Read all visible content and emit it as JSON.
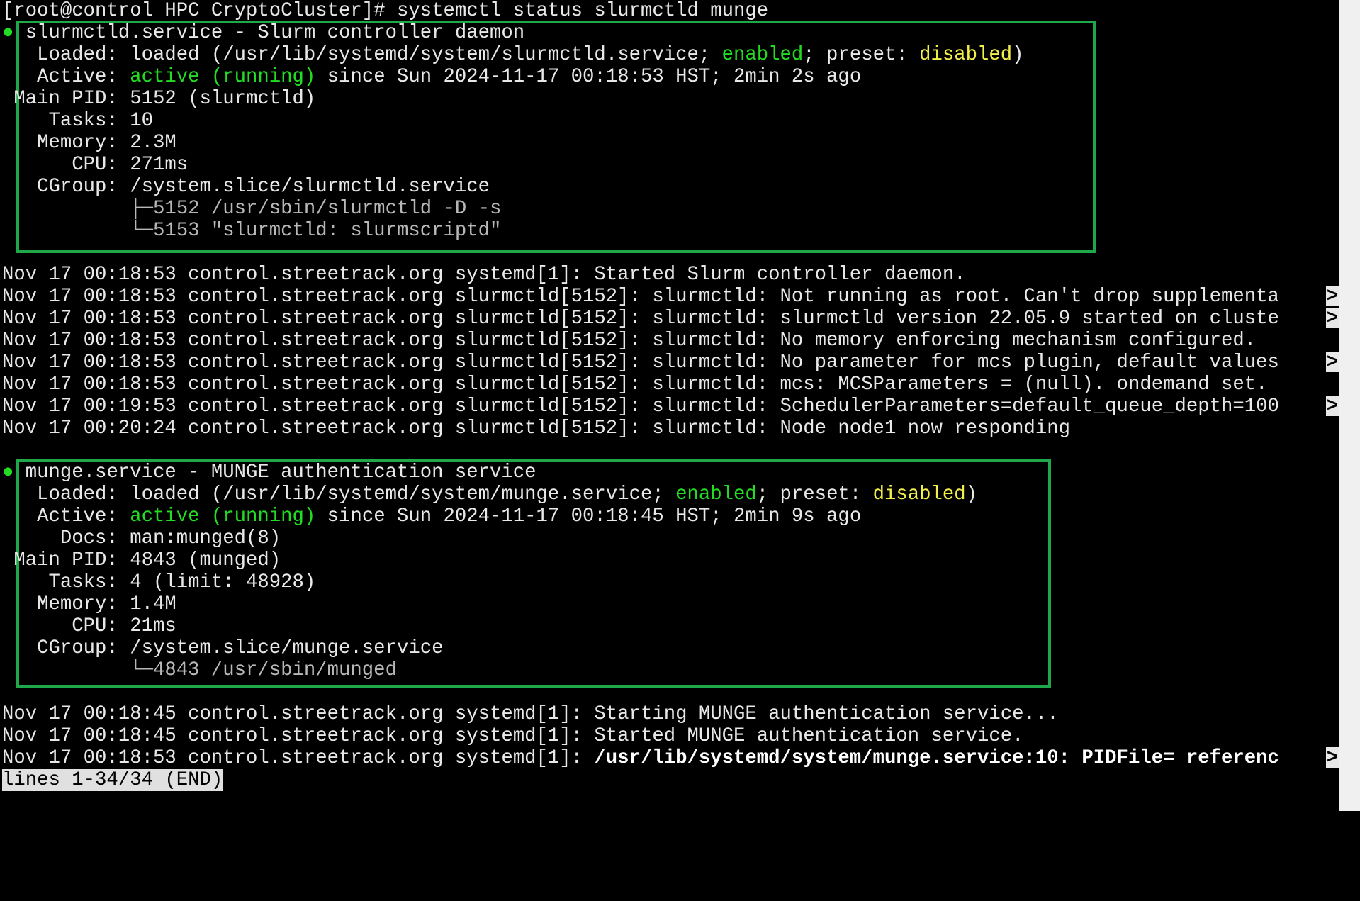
{
  "prompt": "[root@control HPC CryptoCluster]# systemctl status slurmctld munge",
  "slurm": {
    "dot": "●",
    "title": "slurmctld.service - Slurm controller daemon",
    "loaded_key": "   Loaded: ",
    "loaded_pre": "loaded (/usr/lib/systemd/system/slurmctld.service; ",
    "loaded_enabled": "enabled",
    "loaded_mid": "; preset: ",
    "loaded_disabled": "disabled",
    "loaded_end": ")",
    "active_key": "   Active: ",
    "active_state": "active (running)",
    "active_rest": " since Sun 2024-11-17 00:18:53 HST; 2min 2s ago",
    "mainpid": " Main PID: 5152 (slurmctld)",
    "tasks": "    Tasks: 10",
    "memory": "   Memory: 2.3M",
    "cpu": "      CPU: 271ms",
    "cgroup": "   CGroup: /system.slice/slurmctld.service",
    "tree1": "           ├─5152 /usr/sbin/slurmctld -D -s",
    "tree2": "           └─5153 \"slurmctld: slurmscriptd\""
  },
  "slurm_logs": [
    {
      "text": "Nov 17 00:18:53 control.streetrack.org systemd[1]: Started Slurm controller daemon.",
      "truncated": false
    },
    {
      "text": "Nov 17 00:18:53 control.streetrack.org slurmctld[5152]: slurmctld: Not running as root. Can't drop supplementa",
      "truncated": true
    },
    {
      "text": "Nov 17 00:18:53 control.streetrack.org slurmctld[5152]: slurmctld: slurmctld version 22.05.9 started on cluste",
      "truncated": true
    },
    {
      "text": "Nov 17 00:18:53 control.streetrack.org slurmctld[5152]: slurmctld: No memory enforcing mechanism configured.",
      "truncated": false
    },
    {
      "text": "Nov 17 00:18:53 control.streetrack.org slurmctld[5152]: slurmctld: No parameter for mcs plugin, default values",
      "truncated": true
    },
    {
      "text": "Nov 17 00:18:53 control.streetrack.org slurmctld[5152]: slurmctld: mcs: MCSParameters = (null). ondemand set.",
      "truncated": false
    },
    {
      "text": "Nov 17 00:19:53 control.streetrack.org slurmctld[5152]: slurmctld: SchedulerParameters=default_queue_depth=100",
      "truncated": true
    },
    {
      "text": "Nov 17 00:20:24 control.streetrack.org slurmctld[5152]: slurmctld: Node node1 now responding",
      "truncated": false
    }
  ],
  "munge": {
    "dot": "●",
    "title": "munge.service - MUNGE authentication service",
    "loaded_key": "   Loaded: ",
    "loaded_pre": "loaded (/usr/lib/systemd/system/munge.service; ",
    "loaded_enabled": "enabled",
    "loaded_mid": "; preset: ",
    "loaded_disabled": "disabled",
    "loaded_end": ")",
    "active_key": "   Active: ",
    "active_state": "active (running)",
    "active_rest": " since Sun 2024-11-17 00:18:45 HST; 2min 9s ago",
    "docs": "     Docs: man:munged(8)",
    "mainpid": " Main PID: 4843 (munged)",
    "tasks": "    Tasks: 4 (limit: 48928)",
    "memory": "   Memory: 1.4M",
    "cpu": "      CPU: 21ms",
    "cgroup": "   CGroup: /system.slice/munge.service",
    "tree1": "           └─4843 /usr/sbin/munged"
  },
  "munge_logs": [
    {
      "text": "Nov 17 00:18:45 control.streetrack.org systemd[1]: Starting MUNGE authentication service...",
      "truncated": false
    },
    {
      "text": "Nov 17 00:18:45 control.streetrack.org systemd[1]: Started MUNGE authentication service.",
      "truncated": false
    }
  ],
  "munge_last_log": {
    "prefix": "Nov 17 00:18:53 control.streetrack.org systemd[1]: ",
    "bold": "/usr/lib/systemd/system/munge.service:10: PIDFile= referenc",
    "truncated": true
  },
  "trunc_marker": ">",
  "pager_status": "lines 1-34/34 (END)",
  "colors": {
    "background": "#000000",
    "text": "#e8e8e8",
    "active_green": "#22dd22",
    "highlight_yellow": "#f2ef4a",
    "box_border": "#1fa84a"
  }
}
